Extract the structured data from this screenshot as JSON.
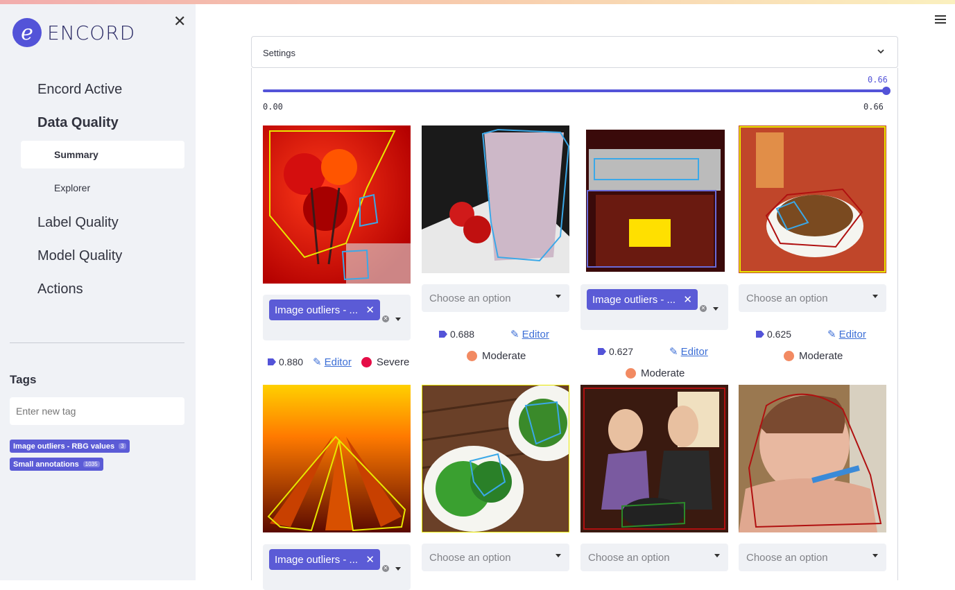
{
  "app": {
    "brand": "ENCORD",
    "logo_letter": "e"
  },
  "sidebar": {
    "close_label": "✕",
    "nav": [
      {
        "label": "Encord Active"
      },
      {
        "label": "Data Quality"
      },
      {
        "label": "Label Quality"
      },
      {
        "label": "Model Quality"
      },
      {
        "label": "Actions"
      }
    ],
    "subnav": [
      {
        "label": "Summary",
        "active": true
      },
      {
        "label": "Explorer",
        "active": false
      }
    ],
    "tags": {
      "title": "Tags",
      "input_placeholder": "Enter new tag",
      "items": [
        {
          "label": "Image outliers - RBG values",
          "count": "3"
        },
        {
          "label": "Small annotations",
          "count": "1035"
        }
      ]
    }
  },
  "main": {
    "settings_label": "Settings",
    "slider": {
      "value": "0.66",
      "min": "0.00",
      "max": "0.66",
      "fraction": 1.0
    },
    "select_placeholder": "Choose an option",
    "chip_label": "Image outliers - ...",
    "editor_label": "Editor",
    "cards": [
      {
        "score": "0.880",
        "severity": "Severe",
        "tagged": true
      },
      {
        "score": "0.688",
        "severity": "Moderate",
        "tagged": false
      },
      {
        "score": "0.627",
        "severity": "Moderate",
        "tagged": true
      },
      {
        "score": "0.625",
        "severity": "Moderate",
        "tagged": false
      },
      {
        "tagged": true
      },
      {
        "tagged": false
      },
      {
        "tagged": false
      },
      {
        "tagged": false
      }
    ]
  },
  "colors": {
    "accent": "#5353d8",
    "severe": "#e50d47",
    "moderate": "#f28a62",
    "link": "#3d6fd6"
  }
}
